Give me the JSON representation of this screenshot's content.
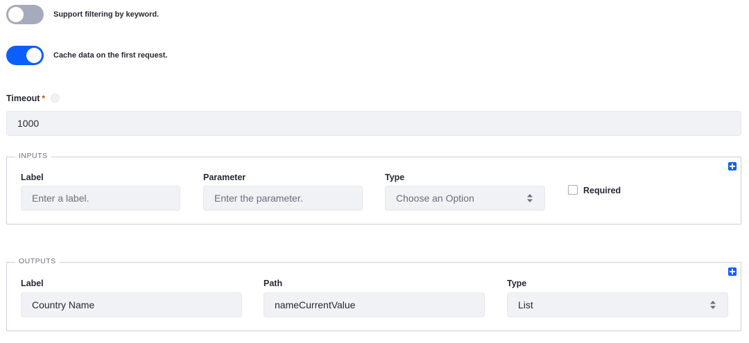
{
  "toggles": {
    "keyword_filter": {
      "label": "Support filtering by keyword.",
      "state": "off"
    },
    "cache_data": {
      "label": "Cache data on the first request.",
      "state": "on"
    }
  },
  "timeout": {
    "label": "Timeout",
    "required_mark": "*",
    "value": "1000"
  },
  "inputs": {
    "legend": "INPUTS",
    "label_col": {
      "label": "Label",
      "placeholder": "Enter a label."
    },
    "parameter_col": {
      "label": "Parameter",
      "placeholder": "Enter the parameter."
    },
    "type_col": {
      "label": "Type",
      "value": "Choose an Option"
    },
    "required": {
      "label": "Required",
      "checked": false
    }
  },
  "outputs": {
    "legend": "OUTPUTS",
    "label_col": {
      "label": "Label",
      "value": "Country Name"
    },
    "path_col": {
      "label": "Path",
      "value": "nameCurrentValue"
    },
    "type_col": {
      "label": "Type",
      "value": "List"
    }
  },
  "icons": {
    "add": "plus-square-icon",
    "select": "caret-double-icon",
    "help": "question-circle-icon"
  },
  "colors": {
    "accent": "#0b5fff",
    "toggle_off": "#a7a9bc",
    "required_star": "#b95000",
    "input_bg": "#f1f2f5"
  }
}
